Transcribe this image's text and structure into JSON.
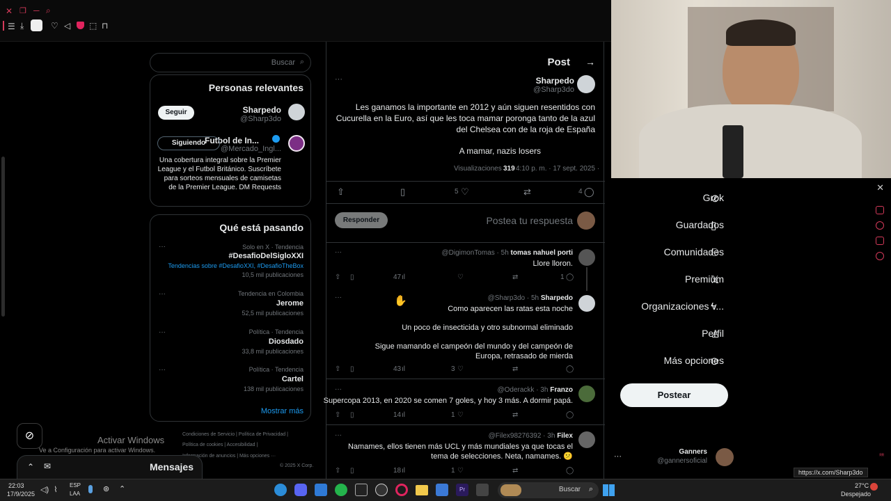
{
  "browser": {
    "toolbar_icons": [
      "menu-icon",
      "download-icon",
      "extension-icon",
      "heart-icon",
      "send-icon",
      "shield-icon",
      "screenshot-icon",
      "pin-icon"
    ],
    "tab_icons": [
      "close-icon",
      "copy-icon",
      "minus-icon",
      "search-icon"
    ]
  },
  "sidebar": {
    "items": [
      {
        "label": "Grok",
        "icon": "grok-icon"
      },
      {
        "label": "Guardados",
        "icon": "bookmark-icon"
      },
      {
        "label": "Comunidades",
        "icon": "communities-icon"
      },
      {
        "label": "Premium",
        "icon": "x-logo-icon"
      },
      {
        "label": "Organizaciones v...",
        "icon": "lightning-icon"
      },
      {
        "label": "Perfil",
        "icon": "person-icon"
      },
      {
        "label": "Más opciones",
        "icon": "more-icon"
      }
    ],
    "post_button": "Postear",
    "account": {
      "name": "Ganners",
      "handle": "@gannersoficial",
      "more": "···"
    },
    "url_tooltip": "https://x.com/Sharp3do"
  },
  "main": {
    "header": {
      "title": "Post"
    },
    "post": {
      "author": "Sharpedo",
      "handle": "@Sharp3do",
      "more": "···",
      "text1": "Les ganamos la importante en 2012 y aún siguen resentidos con Cucurella en la Euro, así que les toca mamar poronga tanto de la azul del Chelsea con de la roja de España",
      "text2": "A mamar, nazis losers",
      "meta_time": "4:10 p. m. · 17 sept. 2025 ·",
      "meta_views": "319",
      "meta_views_label": "Visualizaciones",
      "stats": {
        "replies": "4",
        "likes": "5"
      }
    },
    "reply_box": {
      "placeholder": "Postea tu respuesta",
      "button": "Responder"
    },
    "replies": [
      {
        "name": "tomas nahuel porti",
        "handle": "@DigimonTomas · 5h",
        "lines": [
          "Llore lloron."
        ],
        "stats": {
          "replies": "1",
          "views": "47"
        }
      },
      {
        "name": "Sharpedo",
        "handle": "@Sharp3do · 5h",
        "lines": [
          "Como aparecen las ratas esta noche",
          "Un poco de insecticida y otro subnormal eliminado",
          "Sigue mamando el campeón del mundo y del campeón de Europa, retrasado de mierda"
        ],
        "stats": {
          "likes": "3",
          "views": "43"
        }
      },
      {
        "name": "Franzo",
        "handle": "@Oderackk · 3h",
        "lines": [
          "Supercopa 2013, en 2020 se comen 7 goles, y hoy 3 más. A dormir papá."
        ],
        "stats": {
          "likes": "1",
          "views": "14"
        }
      },
      {
        "name": "Filex",
        "handle": "@Filex98276392 · 3h",
        "lines": [
          "Namames, ellos tienen más UCL y más mundiales ya que tocas el tema de selecciones. Neta, namames. 😕"
        ],
        "stats": {
          "likes": "1",
          "views": "18"
        }
      }
    ]
  },
  "right": {
    "search_placeholder": "Buscar",
    "relevant": {
      "title": "Personas relevantes",
      "people": [
        {
          "name": "Sharpedo",
          "handle": "@Sharp3do",
          "button": "Seguir"
        },
        {
          "name": "Futbol de In...",
          "handle": "@Mercado_Ingl...",
          "button": "Siguiendo",
          "bio": "Una cobertura integral sobre la Premier League y el Futbol Británico. Suscríbete para sorteos mensuales de camisetas de la Premier League. DM Requests"
        }
      ]
    },
    "trends": {
      "title": "Qué está pasando",
      "items": [
        {
          "context": "Solo en X · Tendencia",
          "name": "#DesafioDelSigloXXI",
          "extra": "Tendencias sobre #DesafioXXI, #DesafioTheBox",
          "count": "10,5 mil publicaciones"
        },
        {
          "context": "Tendencia en Colombia",
          "name": "Jerome",
          "extra": "",
          "count": "52,5 mil publicaciones"
        },
        {
          "context": "Política · Tendencia",
          "name": "Diosdado",
          "extra": "",
          "count": "33,8 mil publicaciones"
        },
        {
          "context": "Política · Tendencia",
          "name": "Cartel",
          "extra": "",
          "count": "138 mil publicaciones"
        }
      ],
      "more": "Mostrar más"
    },
    "footer": {
      "line1": "Condiciones de Servicio  |  Política de Privacidad  |",
      "line2": "Política de cookies  |  Accesibilidad  |",
      "line3": "Información de anuncios  |  Más opciones ···",
      "line4": "© 2025 X Corp."
    },
    "activate": {
      "title": "Activar Windows",
      "sub": "Ve a Configuración para activar Windows."
    },
    "messages": "Mensajes"
  },
  "taskbar": {
    "time": "22:03",
    "date": "17/9/2025",
    "lang1": "ESP",
    "lang2": "LAA",
    "search": "Buscar",
    "weather_temp": "27°C",
    "weather_text": "Despejado"
  }
}
